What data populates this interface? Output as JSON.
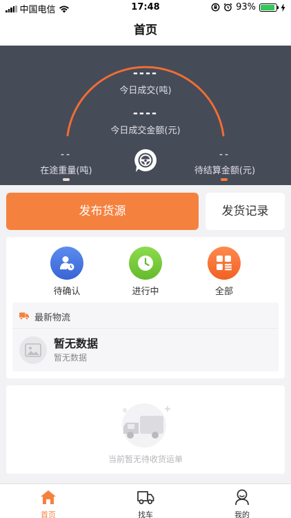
{
  "status_bar": {
    "carrier": "中国电信",
    "time": "17:48",
    "battery_percent": "93%",
    "battery_level": 0.93,
    "battery_color": "#34c759"
  },
  "nav": {
    "title": "首页"
  },
  "dashboard": {
    "arc_color": "#f26d33",
    "today_volume_value": "----",
    "today_volume_label": "今日成交(吨)",
    "today_amount_value": "----",
    "today_amount_label": "今日成交金额(元)",
    "in_transit_value": "--",
    "in_transit_label": "在途重量(吨)",
    "pending_settle_value": "--",
    "pending_settle_label": "待结算金额(元)",
    "center_icon": "steering-wheel-icon"
  },
  "actions": {
    "publish_label": "发布货源",
    "history_label": "发货记录",
    "accent_color": "#f5813f"
  },
  "order_categories": [
    {
      "label": "待确认",
      "icon": "user-clock-icon",
      "color": "#4a78e6"
    },
    {
      "label": "进行中",
      "icon": "clock-icon",
      "color": "#77cc3a"
    },
    {
      "label": "全部",
      "icon": "grid-list-icon",
      "color": "#f66e2e"
    }
  ],
  "logistics": {
    "header": "最新物流",
    "header_icon": "truck-icon",
    "empty_title": "暂无数据",
    "empty_subtitle": "暂无数据",
    "placeholder_icon": "image-icon"
  },
  "empty_state": {
    "icon": "empty-truck-icon",
    "text": "当前暂无待收货运单"
  },
  "tabbar": {
    "items": [
      {
        "label": "首页",
        "icon": "home-icon",
        "active": true
      },
      {
        "label": "找车",
        "icon": "truck-outline-icon",
        "active": false
      },
      {
        "label": "我的",
        "icon": "user-icon",
        "active": false
      }
    ],
    "active_color": "#f5813f"
  }
}
